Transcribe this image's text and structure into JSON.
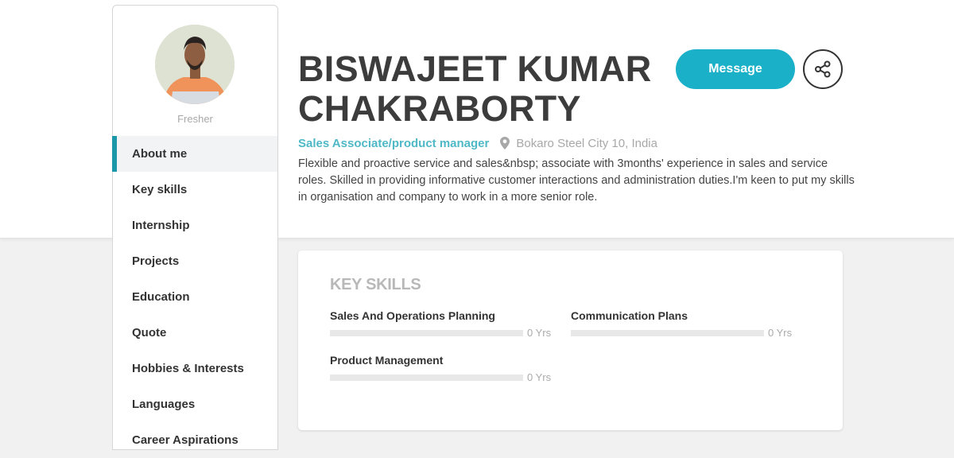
{
  "profile": {
    "name": "BISWAJEET KUMAR CHAKRABORTY",
    "experience_level": "Fresher",
    "job_title": "Sales Associate/product manager",
    "location": "Bokaro Steel City 10, India",
    "about": "Flexible and proactive service and sales&nbsp; associate with 3months' experience in sales and service roles. Skilled in providing informative customer interactions and administration duties.I'm keen to put my skills in organisation and company to work in a more senior role.",
    "avatar_icon": "profile-photo"
  },
  "actions": {
    "message_label": "Message",
    "share_icon": "share-icon"
  },
  "sidebar": {
    "items": [
      {
        "label": "About me",
        "active": true
      },
      {
        "label": "Key skills",
        "active": false
      },
      {
        "label": "Internship",
        "active": false
      },
      {
        "label": "Projects",
        "active": false
      },
      {
        "label": "Education",
        "active": false
      },
      {
        "label": "Quote",
        "active": false
      },
      {
        "label": "Hobbies & Interests",
        "active": false
      },
      {
        "label": "Languages",
        "active": false
      },
      {
        "label": "Career Aspirations",
        "active": false
      }
    ]
  },
  "key_skills": {
    "title": "KEY SKILLS",
    "skills": [
      {
        "name": "Sales And Operations Planning",
        "years": "0 Yrs",
        "level": 0
      },
      {
        "name": "Communication Plans",
        "years": "0 Yrs",
        "level": 0
      },
      {
        "name": "Product Management",
        "years": "0 Yrs",
        "level": 0
      }
    ]
  },
  "colors": {
    "accent": "#1ab0c8",
    "active_marker": "#1a97a8",
    "job_title": "#4fb8c6"
  }
}
